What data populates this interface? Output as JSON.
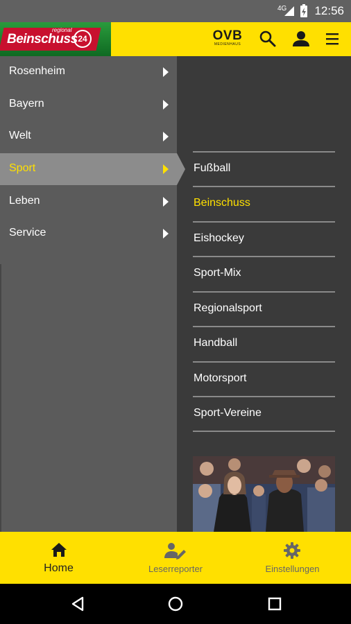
{
  "status_bar": {
    "network": "4G",
    "time": "12:56"
  },
  "app_bar": {
    "logo": {
      "brand": "Beinschuss",
      "tag": "regional",
      "badge": "24"
    },
    "partner": {
      "name": "OVB",
      "subtitle": "MEDIENHAUS"
    },
    "icons": [
      "search-icon",
      "account-icon",
      "hamburger-menu-icon"
    ]
  },
  "menu": {
    "main_items": [
      {
        "label": "Rosenheim",
        "active": false
      },
      {
        "label": "Bayern",
        "active": false
      },
      {
        "label": "Welt",
        "active": false
      },
      {
        "label": "Sport",
        "active": true
      },
      {
        "label": "Leben",
        "active": false
      },
      {
        "label": "Service",
        "active": false
      }
    ],
    "sub_items": [
      {
        "label": "Fußball",
        "selected": false
      },
      {
        "label": "Beinschuss",
        "selected": true
      },
      {
        "label": "Eishockey",
        "selected": false
      },
      {
        "label": "Sport-Mix",
        "selected": false
      },
      {
        "label": "Regionalsport",
        "selected": false
      },
      {
        "label": "Handball",
        "selected": false
      },
      {
        "label": "Motorsport",
        "selected": false
      },
      {
        "label": "Sport-Vereine",
        "selected": false
      }
    ]
  },
  "bottom_nav": {
    "tabs": [
      {
        "label": "Home",
        "icon": "home-icon",
        "active": true
      },
      {
        "label": "Leserreporter",
        "icon": "reporter-icon",
        "active": false
      },
      {
        "label": "Einstellungen",
        "icon": "gear-icon",
        "active": false
      }
    ]
  },
  "system_nav": {
    "buttons": [
      "back-icon",
      "home-circle-icon",
      "recents-icon"
    ]
  },
  "colors": {
    "accent": "#ffe000",
    "menu_bg": "#5b5b5b",
    "submenu_bg": "#3a3a3a",
    "active_item": "#8c8c8c"
  }
}
